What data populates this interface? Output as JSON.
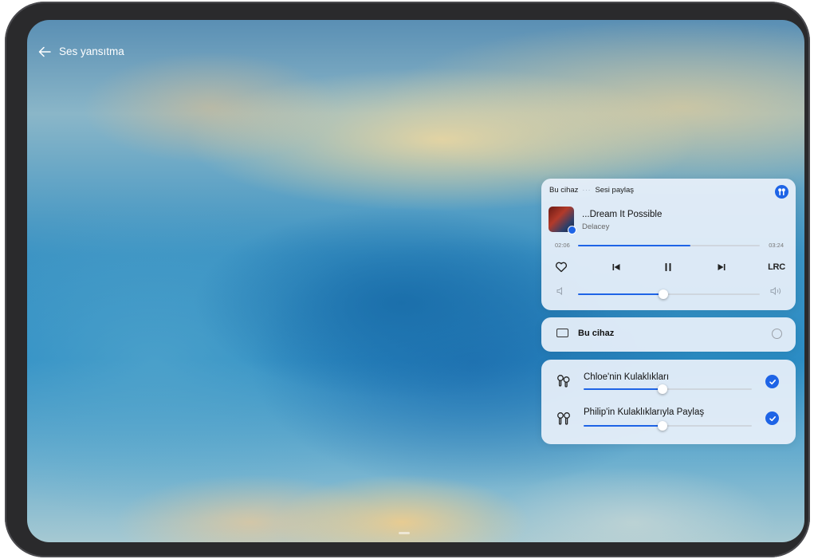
{
  "header": {
    "title": "Ses yansıtma"
  },
  "player": {
    "source_label": "Bu cihaz",
    "connector": "···",
    "share_label": "Sesi paylaş",
    "song_title": "...Dream It Possible",
    "artist": "Delacey",
    "elapsed": "02:06",
    "duration": "03:24",
    "progress_fraction": 0.62,
    "volume_fraction": 0.47,
    "lyrics_label": "LRC"
  },
  "device_option": {
    "label": "Bu cihaz",
    "selected": false
  },
  "headphones": [
    {
      "name": "Chloe'nin Kulaklıkları",
      "volume_fraction": 0.47,
      "selected": true
    },
    {
      "name": "Philip'in Kulaklıklarıyla Paylaş",
      "volume_fraction": 0.47,
      "selected": true
    }
  ],
  "colors": {
    "accent": "#1e64e6",
    "card_bg": "#e8f0fa",
    "bezel": "#2a2a2c"
  },
  "icons": {
    "back": "arrow-left-icon",
    "share": "headphones-share-icon",
    "heart": "heart-icon",
    "prev": "skip-previous-icon",
    "pause": "pause-icon",
    "next": "skip-next-icon",
    "vol_low": "volume-low-icon",
    "vol_high": "volume-high-icon",
    "device": "tablet-icon",
    "earbuds": "earbuds-icon",
    "check": "check-icon"
  }
}
